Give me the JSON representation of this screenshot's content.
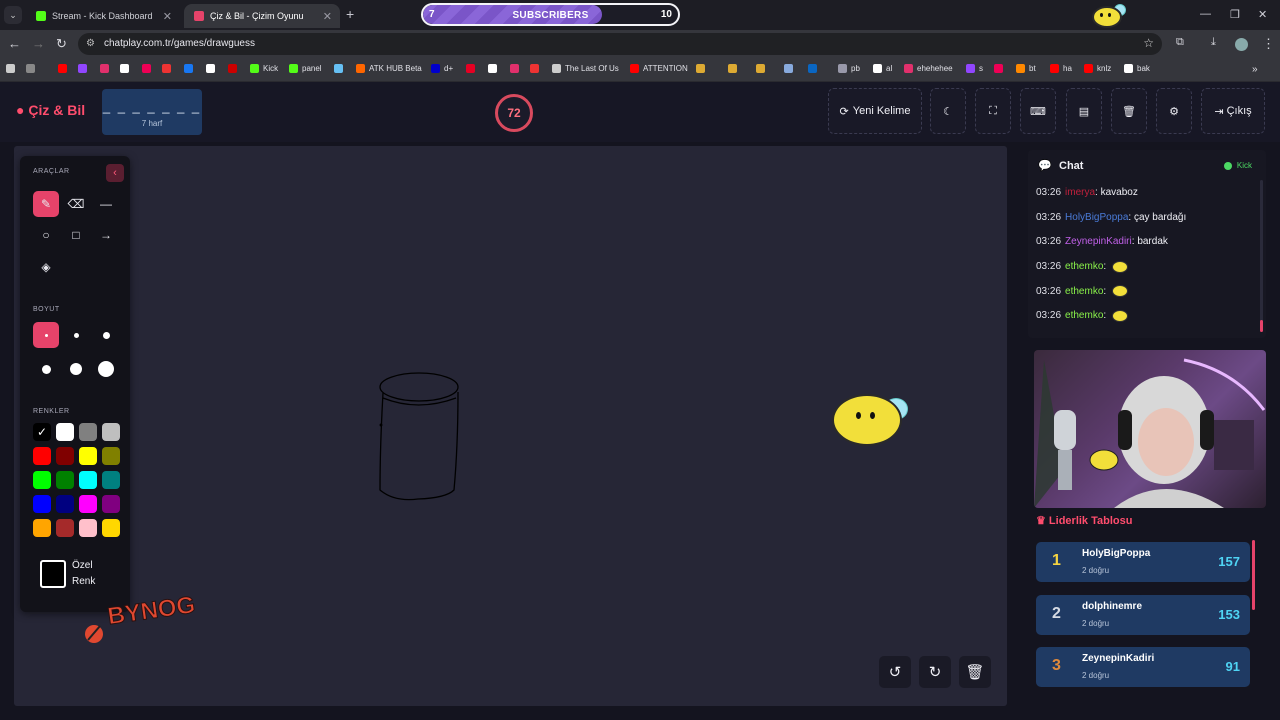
{
  "browser": {
    "tabs": [
      {
        "title": "Stream - Kick Dashboard",
        "favicon_color": "#53fc18"
      },
      {
        "title": "Çiz & Bil - Çizim Oyunu",
        "favicon_color": "#e6436a"
      }
    ],
    "url": "chatplay.com.tr/games/drawguess",
    "bookmarks": [
      "Kick",
      "panel",
      "ATK HUB Beta",
      "d+",
      "The Last Of Us",
      "ATTENTION",
      "pb",
      "al",
      "ehehehee",
      "s",
      "bt",
      "ha",
      "knlz",
      "bak"
    ]
  },
  "subscribers_overlay": {
    "current": "7",
    "label": "SUBSCRIBERS",
    "goal": "10",
    "progress_fraction": 0.7
  },
  "app": {
    "logo": "Çiz & Bil",
    "word_mask": "_ _ _ _ _ _ _",
    "word_hint": "7 harf",
    "timer": "72",
    "buttons": {
      "new_word": "Yeni Kelime",
      "exit": "Çıkış"
    }
  },
  "tools": {
    "tools_title": "ARAÇLAR",
    "size_title": "BOYUT",
    "colors_title": "RENKLER",
    "custom_color_line1": "Özel",
    "custom_color_line2": "Renk",
    "palette": [
      "#000000",
      "#ffffff",
      "#808080",
      "#bfbfbf",
      "#ff0000",
      "#800000",
      "#ffff00",
      "#808000",
      "#00ff00",
      "#008000",
      "#00ffff",
      "#008080",
      "#0000ff",
      "#000080",
      "#ff00ff",
      "#800080",
      "#ffa500",
      "#a52a2a",
      "#ffc0cb",
      "#ffd700"
    ]
  },
  "chat": {
    "title": "Chat",
    "source": "Kick",
    "messages": [
      {
        "time": "03:26",
        "user": "imerya",
        "user_color": "#c0203c",
        "text": "kavaboz",
        "emote": false
      },
      {
        "time": "03:26",
        "user": "HolyBigPoppa",
        "user_color": "#4a7bd8",
        "text": "çay bardağı",
        "emote": false
      },
      {
        "time": "03:26",
        "user": "ZeynepinKadiri",
        "user_color": "#c060e8",
        "text": "bardak",
        "emote": false
      },
      {
        "time": "03:26",
        "user": "ethemko",
        "user_color": "#8af24a",
        "text": "",
        "emote": true
      },
      {
        "time": "03:26",
        "user": "ethemko",
        "user_color": "#8af24a",
        "text": "",
        "emote": true
      },
      {
        "time": "03:26",
        "user": "ethemko",
        "user_color": "#8af24a",
        "text": "",
        "emote": true
      }
    ]
  },
  "leaderboard": {
    "title": "Liderlik Tablosu",
    "rows": [
      {
        "rank": "1",
        "name": "HolyBigPoppa",
        "sub": "2 doğru",
        "score": "157",
        "rank_color": "#f5d442"
      },
      {
        "rank": "2",
        "name": "dolphinemre",
        "sub": "2 doğru",
        "score": "153",
        "rank_color": "#d6dbe4"
      },
      {
        "rank": "3",
        "name": "ZeynepinKadiri",
        "sub": "2 doğru",
        "score": "91",
        "rank_color": "#e08a3c"
      }
    ]
  },
  "watermark": "BYNOG"
}
